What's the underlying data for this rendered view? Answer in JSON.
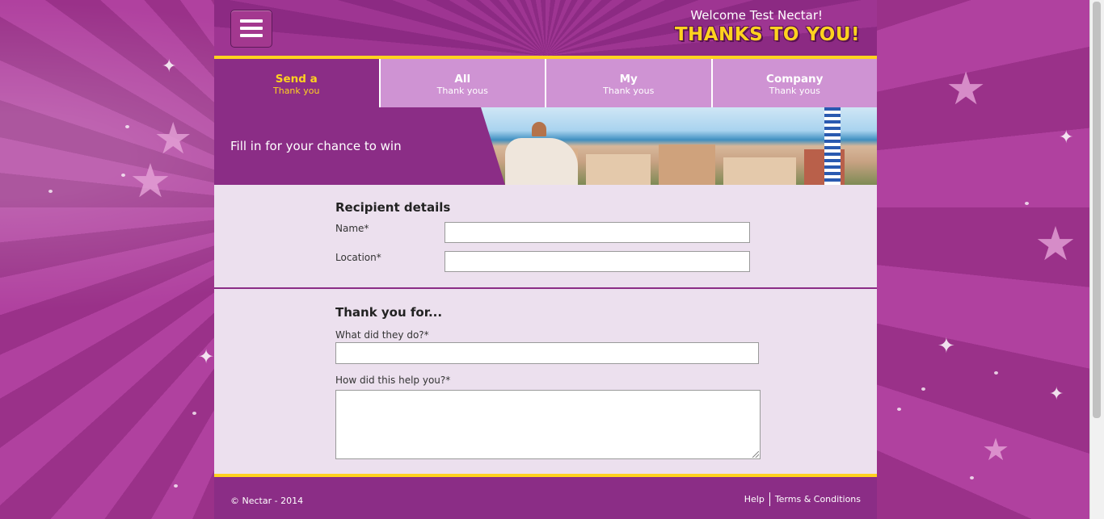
{
  "header": {
    "menu_icon": "hamburger-menu-icon",
    "welcome": "Welcome Test Nectar!",
    "brand": "THANKS TO YOU!"
  },
  "tabs": [
    {
      "line1": "Send a",
      "line2": "Thank you",
      "active": true
    },
    {
      "line1": "All",
      "line2": "Thank yous",
      "active": false
    },
    {
      "line1": "My",
      "line2": "Thank yous",
      "active": false
    },
    {
      "line1": "Company",
      "line2": "Thank yous",
      "active": false
    }
  ],
  "banner": {
    "text": "Fill in for your chance to win"
  },
  "recipient": {
    "title": "Recipient details",
    "name_label": "Name*",
    "name_value": "",
    "location_label": "Location*",
    "location_value": ""
  },
  "thanks": {
    "title": "Thank you for...",
    "what_label": "What did they do?*",
    "what_value": "",
    "how_label": "How did this help you?*",
    "how_value": ""
  },
  "footer": {
    "copyright": "© Nectar - 2014",
    "help": "Help",
    "terms": "Terms & Conditions"
  },
  "colors": {
    "primary_purple": "#8b2d86",
    "light_purple": "#cf93d3",
    "accent_yellow": "#ffd21f",
    "form_bg": "#ece0ee"
  }
}
